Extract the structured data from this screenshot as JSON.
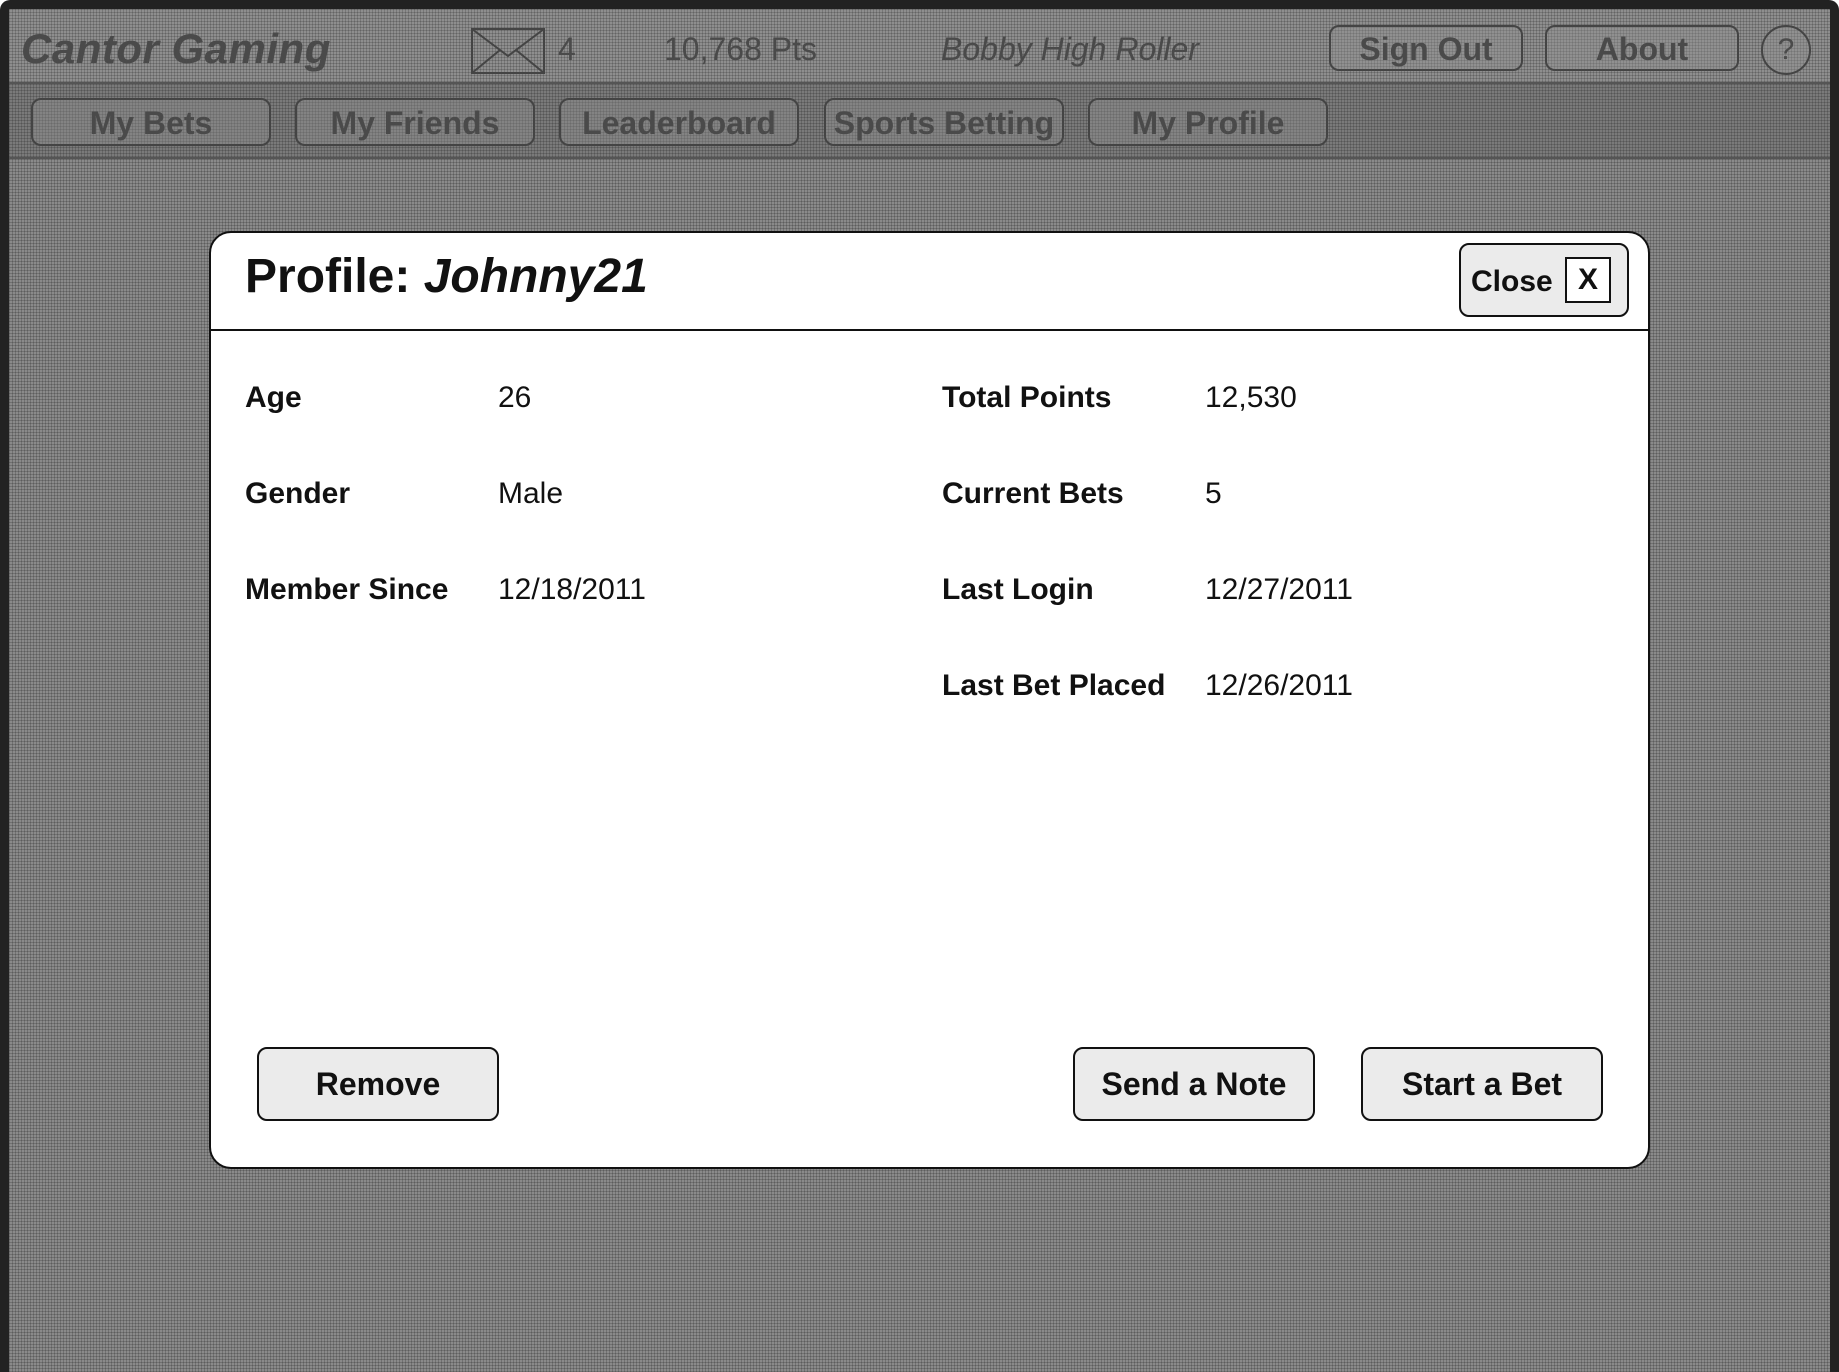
{
  "header": {
    "app_title": "Cantor Gaming",
    "mail_icon": "envelope-icon",
    "mail_count": "4",
    "points": "10,768 Pts",
    "user_name": "Bobby High Roller",
    "sign_out_label": "Sign Out",
    "about_label": "About",
    "help_label": "?"
  },
  "nav": {
    "items": [
      {
        "label": "My Bets"
      },
      {
        "label": "My Friends"
      },
      {
        "label": "Leaderboard"
      },
      {
        "label": "Sports Betting"
      },
      {
        "label": "My Profile"
      }
    ]
  },
  "modal": {
    "title_prefix": "Profile:",
    "username": "Johnny21",
    "close_label": "Close",
    "close_x": "X",
    "left_fields": [
      {
        "label": "Age",
        "value": "26"
      },
      {
        "label": "Gender",
        "value": "Male"
      },
      {
        "label": "Member Since",
        "value": "12/18/2011"
      }
    ],
    "right_fields": [
      {
        "label": "Total Points",
        "value": "12,530"
      },
      {
        "label": "Current Bets",
        "value": "5"
      },
      {
        "label": "Last Login",
        "value": "12/27/2011"
      },
      {
        "label": "Last Bet Placed",
        "value": "12/26/2011"
      }
    ],
    "remove_label": "Remove",
    "send_note_label": "Send a Note",
    "start_bet_label": "Start a Bet"
  }
}
